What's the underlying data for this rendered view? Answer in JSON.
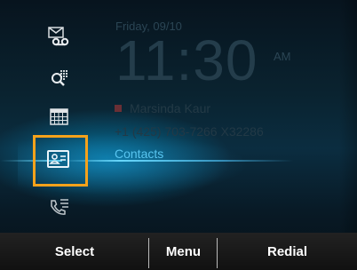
{
  "status": {
    "date": "Friday, 09/10",
    "time": "11:30",
    "ampm": "AM"
  },
  "line": {
    "name": "Marsinda Kaur",
    "number": "+1 (425) 703-7266 X32286"
  },
  "menu": {
    "selected_label": "Contacts",
    "items": [
      {
        "icon": "voicemail-icon"
      },
      {
        "icon": "search-directory-icon"
      },
      {
        "icon": "calendar-icon"
      },
      {
        "icon": "contacts-card-icon"
      },
      {
        "icon": "call-log-icon"
      }
    ]
  },
  "softkeys": {
    "select": "Select",
    "menu": "Menu",
    "redial": "Redial"
  },
  "colors": {
    "highlight": "#f5a21b",
    "accent": "#58c5f0"
  }
}
